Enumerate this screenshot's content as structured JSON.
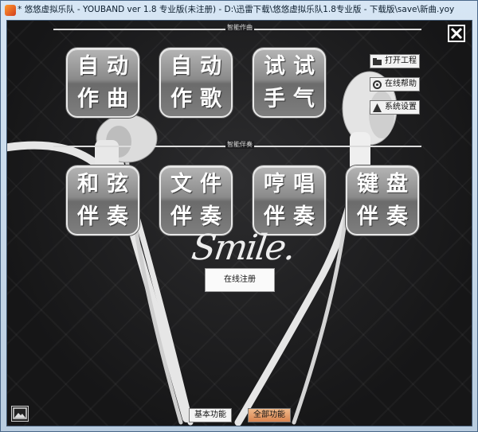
{
  "window": {
    "title": "* 悠悠虚拟乐队 - YOUBAND ver 1.8  专业版(未注册)  -  D:\\迅雷下载\\悠悠虚拟乐队1.8专业版 - 下载版\\save\\新曲.yoy"
  },
  "sections": {
    "compose_label": "智能作曲",
    "accompany_label": "智能伴奏"
  },
  "compose_buttons": [
    {
      "line1": "自动",
      "line2": "作曲"
    },
    {
      "line1": "自动",
      "line2": "作歌"
    },
    {
      "line1": "试试",
      "line2": "手气"
    }
  ],
  "accompany_buttons": [
    {
      "line1": "和弦",
      "line2": "伴奏"
    },
    {
      "line1": "文件",
      "line2": "伴奏"
    },
    {
      "line1": "哼唱",
      "line2": "伴奏"
    },
    {
      "line1": "键盘",
      "line2": "伴奏"
    }
  ],
  "side_buttons": {
    "open_project": "打开工程",
    "online_help": "在线帮助",
    "system_settings": "系统设置"
  },
  "decor": {
    "smile": "Smile."
  },
  "register_label": "在线注册",
  "bottom": {
    "basic_label": "基本功能",
    "all_label": "全部功能"
  },
  "colors": {
    "background": "#1b1b1d",
    "button_gray": "#8a8a8a",
    "accent_orange": "#d9834e"
  }
}
